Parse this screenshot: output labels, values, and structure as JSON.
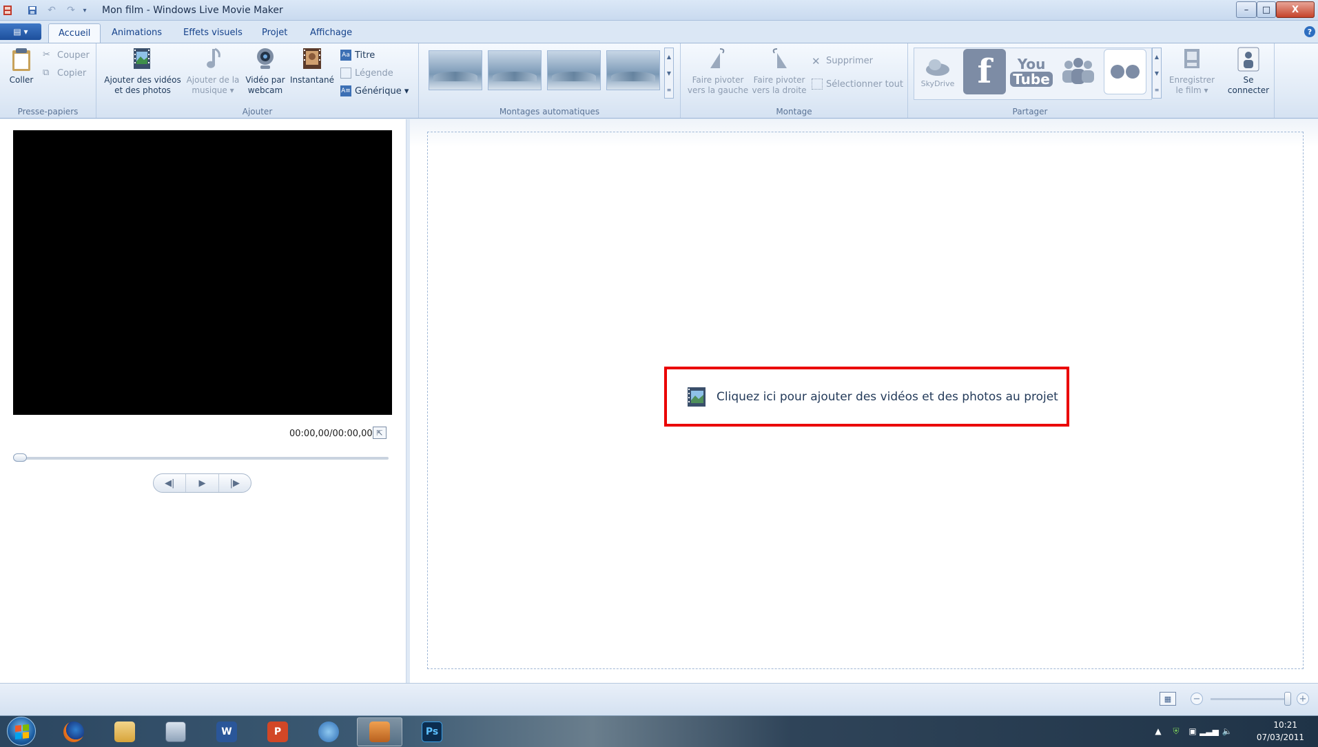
{
  "window": {
    "title": "Mon film - Windows Live Movie Maker",
    "quick_access": [
      "save-icon",
      "undo-icon",
      "redo-icon",
      "customize-icon"
    ],
    "controls": {
      "minimize": "–",
      "maximize": "□",
      "close": "X"
    }
  },
  "tabs": [
    {
      "label": "Accueil",
      "active": true
    },
    {
      "label": "Animations",
      "active": false
    },
    {
      "label": "Effets visuels",
      "active": false
    },
    {
      "label": "Projet",
      "active": false
    },
    {
      "label": "Affichage",
      "active": false
    }
  ],
  "ribbon": {
    "clipboard": {
      "label": "Presse-papiers",
      "paste": "Coller",
      "cut": "Couper",
      "copy": "Copier"
    },
    "add": {
      "label": "Ajouter",
      "add_media_line1": "Ajouter des vidéos",
      "add_media_line2": "et des photos",
      "add_music_line1": "Ajouter de la",
      "add_music_line2": "musique ▾",
      "webcam_line1": "Vidéo par",
      "webcam_line2": "webcam",
      "snapshot": "Instantané",
      "title": "Titre",
      "caption": "Légende",
      "credits": "Générique ▾"
    },
    "automovies": {
      "label": "Montages automatiques"
    },
    "editing": {
      "label": "Montage",
      "rotate_left_line1": "Faire pivoter",
      "rotate_left_line2": "vers la gauche",
      "rotate_right_line1": "Faire pivoter",
      "rotate_right_line2": "vers la droite",
      "delete": "Supprimer",
      "select_all": "Sélectionner tout"
    },
    "share": {
      "label": "Partager",
      "skydrive": "SkyDrive",
      "youtube_top": "You",
      "youtube_bottom": "Tube",
      "save_movie_line1": "Enregistrer",
      "save_movie_line2": "le film ▾",
      "sign_in_line1": "Se",
      "sign_in_line2": "connecter"
    }
  },
  "preview": {
    "time": "00:00,00/00:00,00"
  },
  "storyboard": {
    "prompt": "Cliquez ici pour ajouter des vidéos et des photos au projet",
    "highlight_color": "#ea0000"
  },
  "taskbar": {
    "clock_time": "10:21",
    "clock_date": "07/03/2011",
    "photoshop_label": "Ps"
  }
}
